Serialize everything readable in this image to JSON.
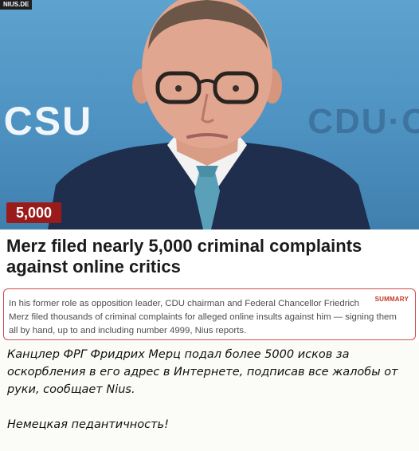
{
  "article_image": {
    "watermark": "NIUS.DE",
    "backdrop_text_left": "·CSU",
    "backdrop_text_right": "CDU·C",
    "count_badge": "5,000",
    "colors": {
      "backdrop": "#5ea2cf",
      "badge": "#9b1b1b",
      "suit": "#1f2e4d",
      "tie": "#5aa0b8"
    }
  },
  "article": {
    "headline_line1": "Merz filed nearly 5,000 criminal complaints",
    "headline_line2": "against online critics",
    "summary_tag": "SUMMARY",
    "summary_line1": "In his former role as opposition leader, CDU chairman and Federal Chancellor Friedrich",
    "summary_line2": "Merz filed thousands of criminal complaints for alleged online insults against him — signing them",
    "summary_line3": "all by hand, up to and including number 4999, Nius reports."
  },
  "comment": {
    "line1": "Канцлер ФРГ Фридрих Мерц подал более 5000 исков за",
    "line2": "оскорбления в его адрес в Интернете, подписав все жалобы от",
    "line3": "руки, сообщает Nius.",
    "line4": "Немецкая педантичность!"
  }
}
